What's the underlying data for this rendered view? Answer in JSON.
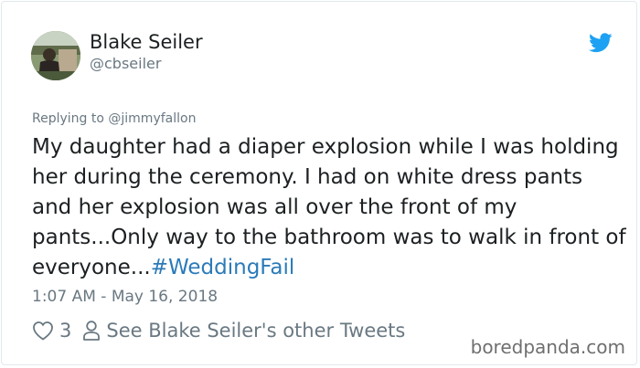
{
  "author": {
    "name": "Blake Seiler",
    "handle": "@cbseiler"
  },
  "reply": {
    "prefix": "Replying to ",
    "mention": "@jimmyfallon"
  },
  "tweet": {
    "text": "My daughter had a diaper explosion while I was holding her during the ceremony. I had on white dress pants and her explosion was all over the front of my pants...Only way to the bathroom was to walk in front of everyone...",
    "hashtag": "#WeddingFail",
    "timestamp": "1:07 AM - May 16, 2018"
  },
  "actions": {
    "like_count": "3",
    "other_tweets_label": "See Blake Seiler's other Tweets"
  },
  "watermark": "boredpanda.com",
  "icons": {
    "brand": "twitter-bird-icon",
    "like": "heart-icon",
    "profile": "person-icon"
  },
  "colors": {
    "twitter_blue": "#1da1f2",
    "hashtag": "#2b7bb9",
    "muted": "#697882",
    "text": "#1c2022"
  }
}
